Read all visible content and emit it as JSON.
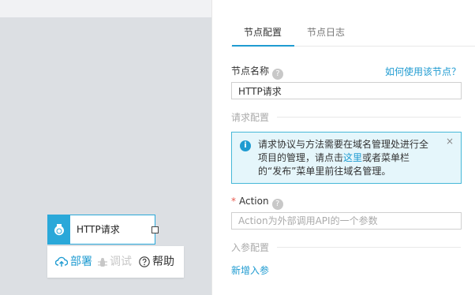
{
  "canvas": {
    "node": {
      "label": "HTTP请求"
    },
    "toolbar": {
      "deploy": "部署",
      "debug": "调试",
      "help": "帮助"
    }
  },
  "panel": {
    "tabs": [
      {
        "label": "节点配置",
        "active": true
      },
      {
        "label": "节点日志",
        "active": false
      }
    ],
    "node_name": {
      "label": "节点名称",
      "help_link": "如何使用该节点？",
      "value": "HTTP请求"
    },
    "request_section": "请求配置",
    "info": {
      "text_before": "请求协议与方法需要在域名管理处进行全项目的管理，请点击",
      "link": "这里",
      "text_after": "或者菜单栏的“发布”菜单里前往域名管理。",
      "close": "×"
    },
    "action": {
      "required_mark": "*",
      "label": "Action",
      "placeholder": "Action为外部调用API的一个参数"
    },
    "input_section": "入参配置",
    "add_param": "新增入参"
  },
  "colors": {
    "accent": "#1f9bd1",
    "info_bg": "#e5f6fb",
    "info_border": "#46b8d8",
    "required": "#e85a4f"
  }
}
